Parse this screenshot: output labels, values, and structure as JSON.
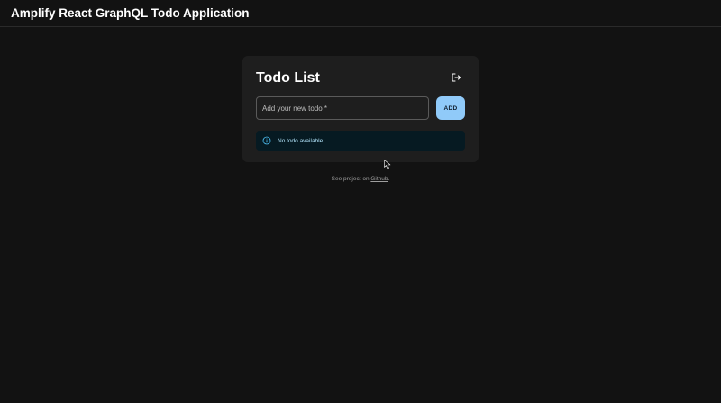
{
  "header": {
    "title": "Amplify React GraphQL Todo Application"
  },
  "card": {
    "title": "Todo List",
    "logout_icon": "logout-icon",
    "input": {
      "placeholder": "Add your new todo *",
      "value": ""
    },
    "add_label": "ADD",
    "alert": {
      "icon": "info-icon",
      "text": "No todo available"
    }
  },
  "footer": {
    "prefix": "See project on ",
    "link_text": "Github",
    "suffix": "."
  },
  "colors": {
    "background": "#121212",
    "card": "#1e1e1e",
    "accent": "#90caf9",
    "alert_bg": "#061a22",
    "alert_text": "#b3e5fc"
  }
}
